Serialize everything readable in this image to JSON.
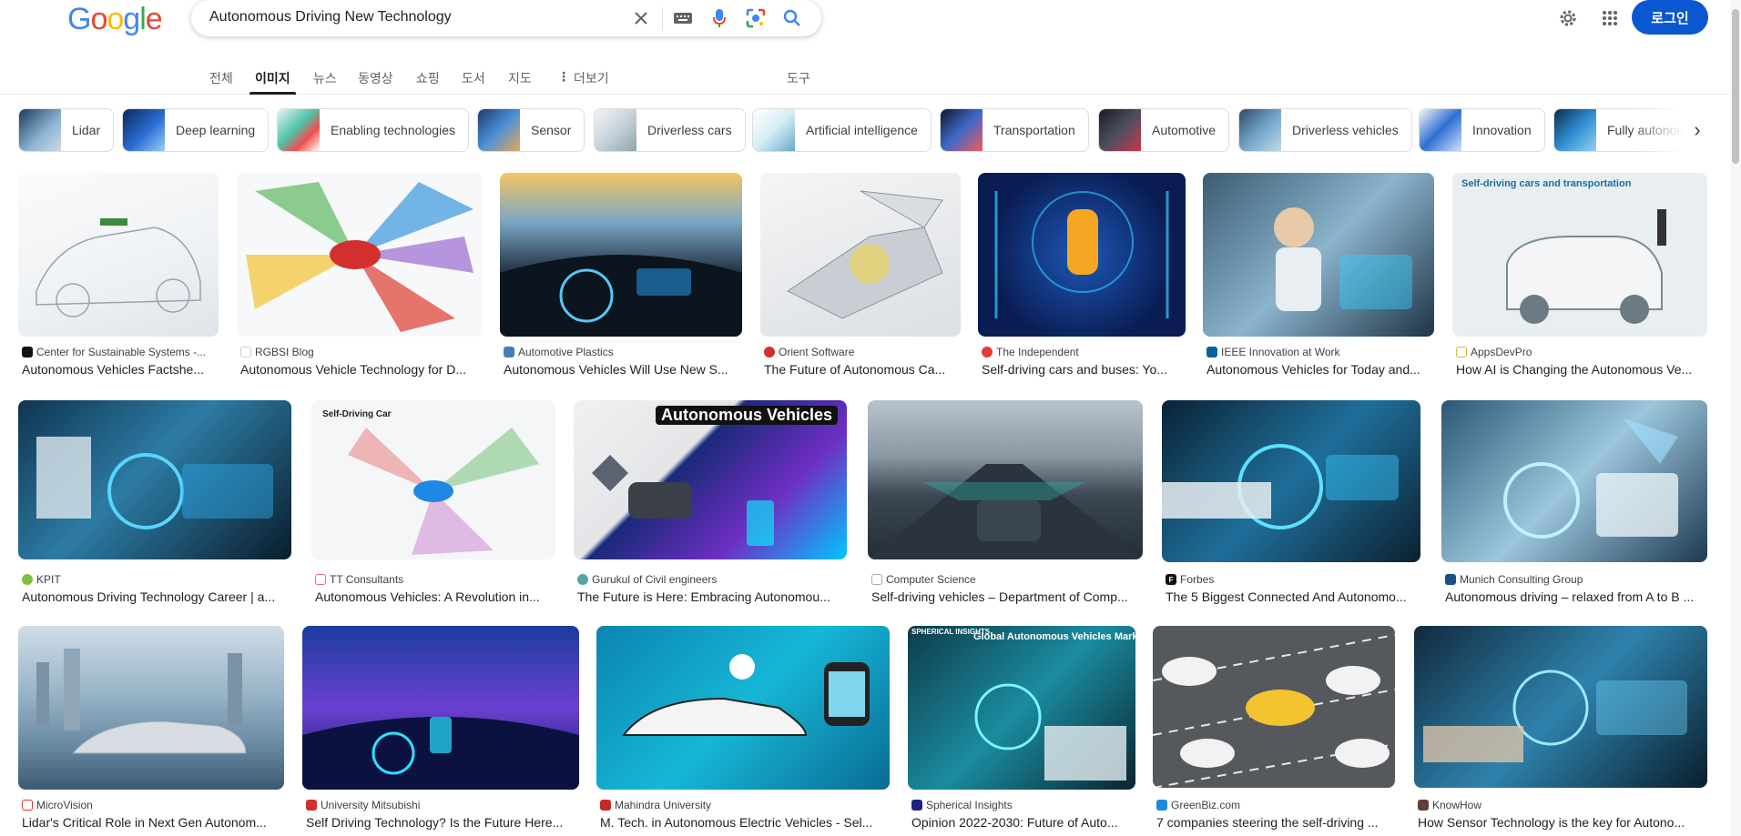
{
  "logo": [
    "G",
    "o",
    "o",
    "g",
    "l",
    "e"
  ],
  "search": {
    "query": "Autonomous Driving New Technology"
  },
  "header": {
    "login_label": "로그인"
  },
  "tabs": [
    {
      "label": "전체"
    },
    {
      "label": "이미지"
    },
    {
      "label": "뉴스"
    },
    {
      "label": "동영상"
    },
    {
      "label": "쇼핑"
    },
    {
      "label": "도서"
    },
    {
      "label": "지도"
    },
    {
      "label": "더보기"
    },
    {
      "label": "도구"
    }
  ],
  "chips": [
    {
      "label": "Lidar"
    },
    {
      "label": "Deep learning"
    },
    {
      "label": "Enabling technologies"
    },
    {
      "label": "Sensor"
    },
    {
      "label": "Driverless cars"
    },
    {
      "label": "Artificial intelligence"
    },
    {
      "label": "Transportation"
    },
    {
      "label": "Automotive"
    },
    {
      "label": "Driverless vehicles"
    },
    {
      "label": "Innovation"
    },
    {
      "label": "Fully autonomous"
    }
  ],
  "results": [
    {
      "source": "Center for Sustainable Systems -...",
      "title": "Autonomous Vehicles Factshe..."
    },
    {
      "source": "RGBSI Blog",
      "title": "Autonomous Vehicle Technology for D..."
    },
    {
      "source": "Automotive Plastics",
      "title": "Autonomous Vehicles Will Use New S..."
    },
    {
      "source": "Orient Software",
      "title": "The Future of Autonomous Ca..."
    },
    {
      "source": "The Independent",
      "title": "Self-driving cars and buses: Yo..."
    },
    {
      "source": "IEEE Innovation at Work",
      "title": "Autonomous Vehicles for Today and..."
    },
    {
      "source": "AppsDevPro",
      "title": "How AI is Changing the Autonomous Ve..."
    },
    {
      "source": "KPIT",
      "title": "Autonomous Driving Technology Career | a..."
    },
    {
      "source": "TT Consultants",
      "title": "Autonomous Vehicles: A Revolution in..."
    },
    {
      "source": "Gurukul of Civil engineers",
      "title": "The Future is Here: Embracing Autonomou..."
    },
    {
      "source": "Computer Science",
      "title": "Self-driving vehicles – Department of Comp..."
    },
    {
      "source": "Forbes",
      "title": "The 5 Biggest Connected And Autonomo..."
    },
    {
      "source": "Munich Consulting Group",
      "title": "Autonomous driving – relaxed from A to B ..."
    },
    {
      "source": "MicroVision",
      "title": "Lidar's Critical Role in Next Gen Autonom..."
    },
    {
      "source": "University Mitsubishi",
      "title": "Self Driving Technology? Is the Future Here..."
    },
    {
      "source": "Mahindra University",
      "title": "M. Tech. in Autonomous Electric Vehicles - Sel..."
    },
    {
      "source": "Spherical Insights",
      "title": "Opinion 2022-2030: Future of Auto..."
    },
    {
      "source": "GreenBiz.com",
      "title": "7 companies steering the self-driving ..."
    },
    {
      "source": "KnowHow",
      "title": "How Sensor Technology is the key for Autono..."
    }
  ],
  "image_text": {
    "self_driving_car": "Self-Driving Car",
    "autonomous_vehicles": "Autonomous Vehicles",
    "self_driving_transport": "Self-driving cars and transportation",
    "global_av_market": "Global Autonomous Vehicles Mark",
    "spherical": "SPHERICAL INSIGHTS"
  }
}
